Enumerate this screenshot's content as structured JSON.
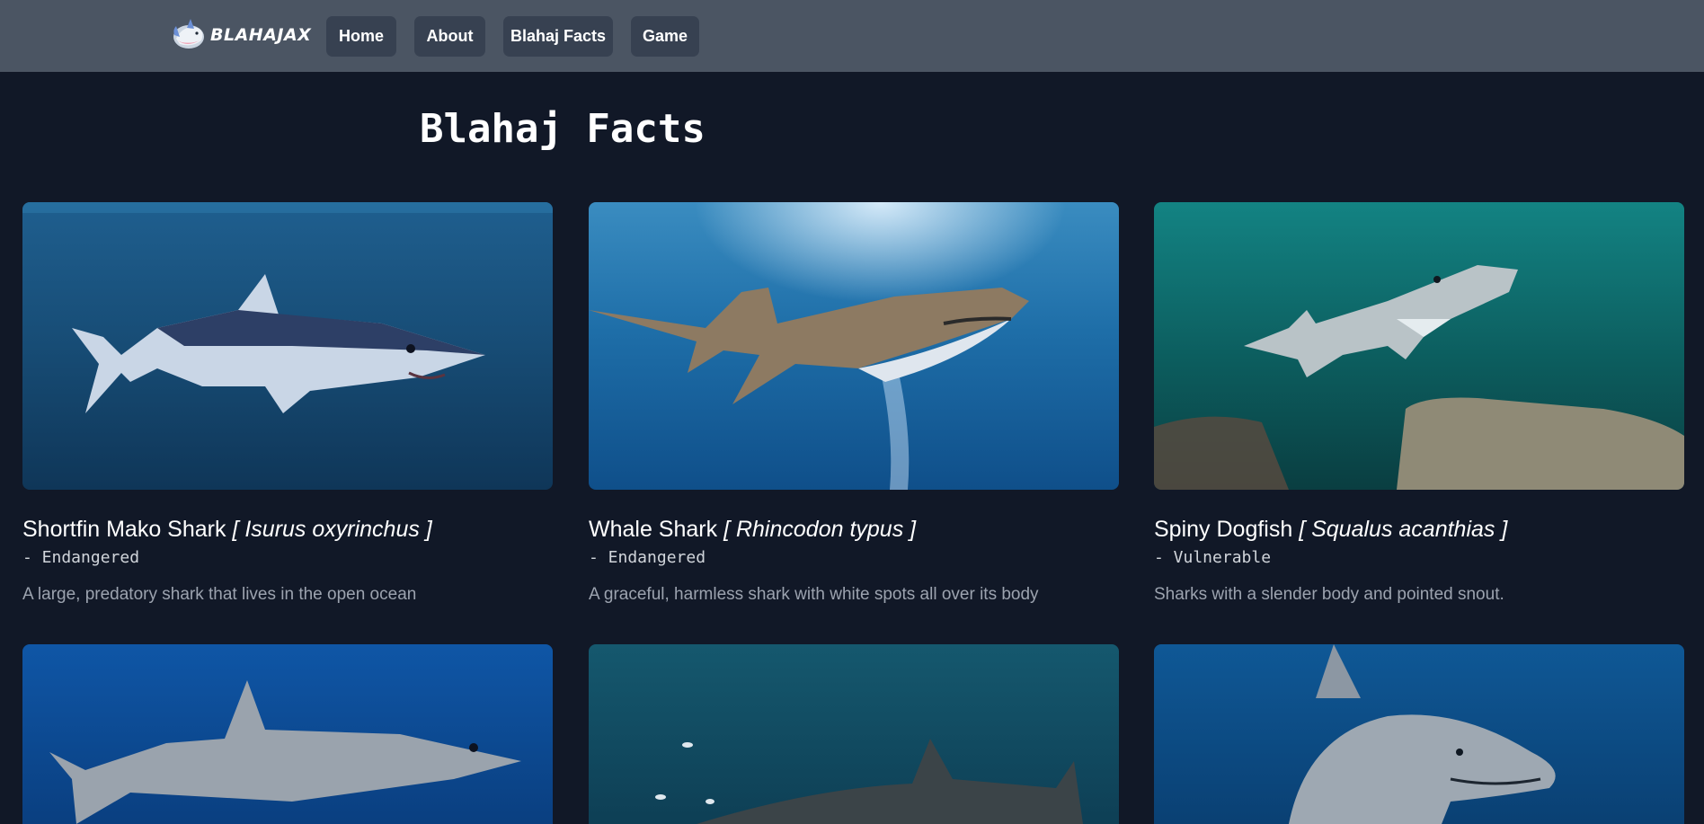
{
  "brand": {
    "name": "BLAHAJAX"
  },
  "nav": {
    "items": [
      {
        "label": "Home"
      },
      {
        "label": "About"
      },
      {
        "label": "Blahaj Facts"
      },
      {
        "label": "Game"
      }
    ]
  },
  "page": {
    "title": "Blahaj Facts"
  },
  "cards": [
    {
      "name": "Shortfin Mako Shark",
      "scientific": "[ Isurus oxyrinchus ]",
      "status": "- Endangered",
      "description": "A large, predatory shark that lives in the open ocean",
      "image_icon": "mako-shark-photo"
    },
    {
      "name": "Whale Shark",
      "scientific": "[ Rhincodon typus ]",
      "status": "- Endangered",
      "description": "A graceful, harmless shark with white spots all over its body",
      "image_icon": "whale-shark-photo"
    },
    {
      "name": "Spiny Dogfish",
      "scientific": "[ Squalus acanthias ]",
      "status": "- Vulnerable",
      "description": "Sharks with a slender body and pointed snout.",
      "image_icon": "dogfish-photo"
    },
    {
      "image_icon": "great-white-shark-photo"
    },
    {
      "image_icon": "tiger-shark-photo"
    },
    {
      "image_icon": "bull-shark-photo"
    }
  ],
  "colors": {
    "background": "#111827",
    "navbar": "#4b5563",
    "nav_button": "#374151"
  }
}
